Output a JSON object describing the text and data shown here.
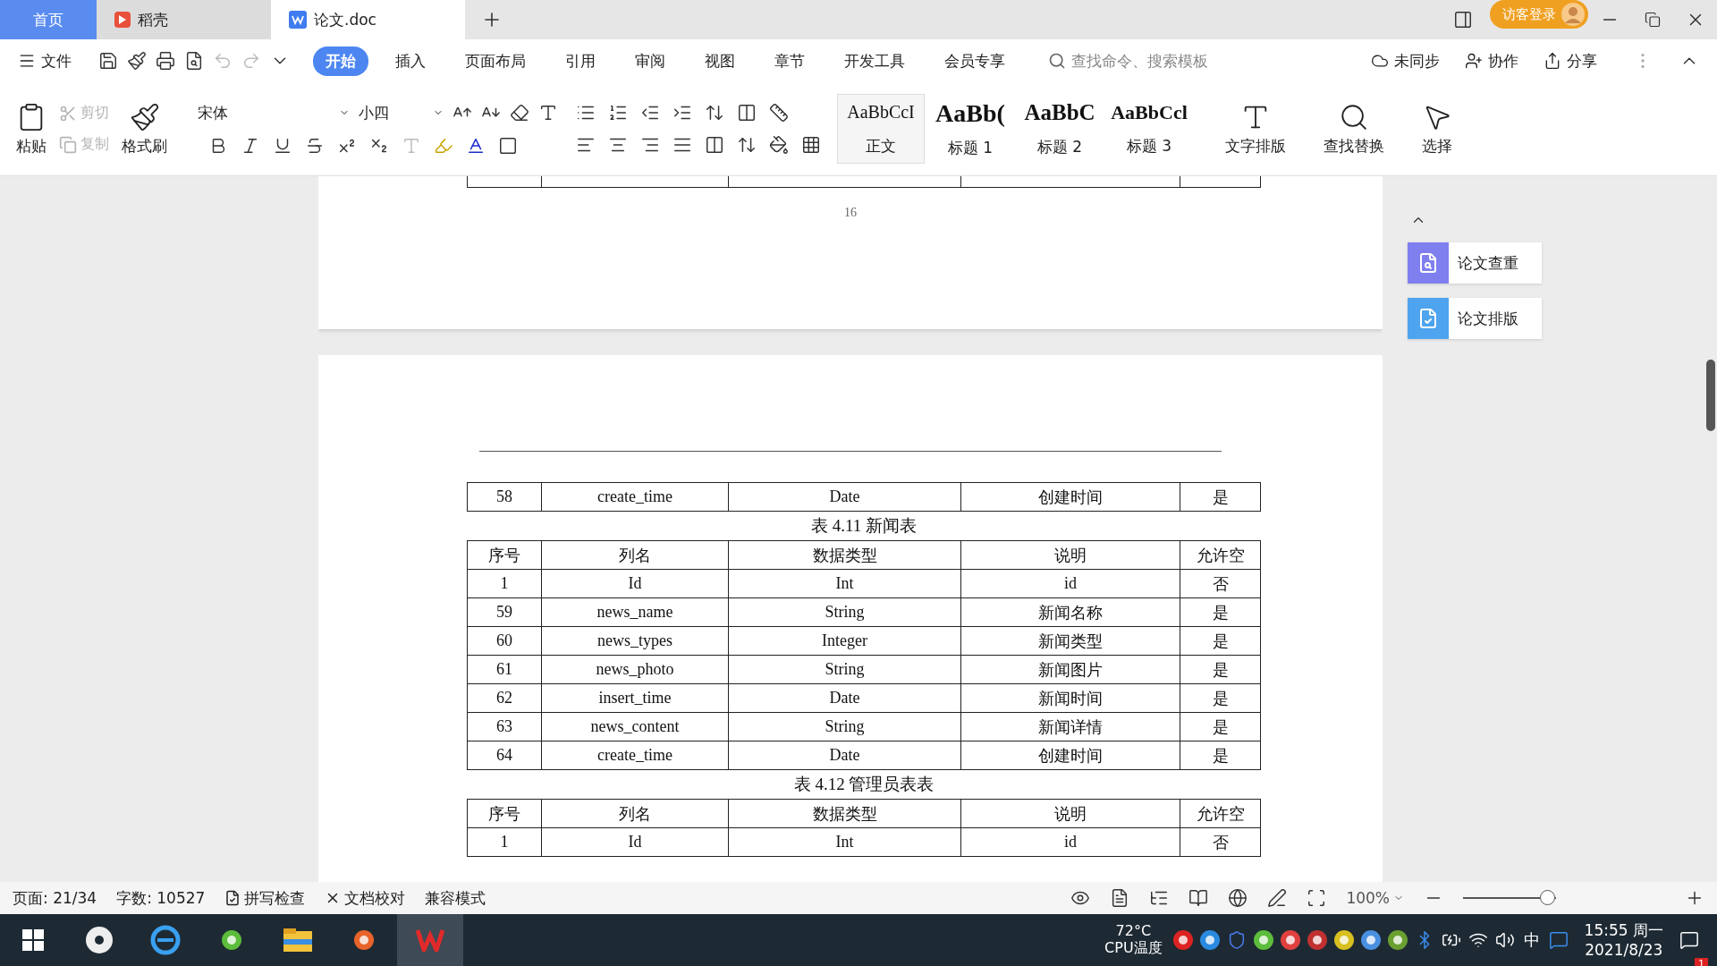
{
  "tabs": [
    {
      "label": "首页",
      "kind": "home",
      "selected": false
    },
    {
      "label": "稻壳",
      "kind": "docer",
      "selected": false
    },
    {
      "label": "论文.doc",
      "kind": "doc",
      "selected": true
    }
  ],
  "title_bar": {
    "login": "访客登录"
  },
  "menu": {
    "file": "文件",
    "items": [
      {
        "label": "开始",
        "selected": true
      },
      {
        "label": "插入",
        "selected": false
      },
      {
        "label": "页面布局",
        "selected": false
      },
      {
        "label": "引用",
        "selected": false
      },
      {
        "label": "审阅",
        "selected": false
      },
      {
        "label": "视图",
        "selected": false
      },
      {
        "label": "章节",
        "selected": false
      },
      {
        "label": "开发工具",
        "selected": false
      },
      {
        "label": "会员专享",
        "selected": false
      }
    ],
    "search": {
      "placeholder": "查找命令、搜索模板"
    },
    "actions": [
      {
        "kind": "sync",
        "label": "未同步"
      },
      {
        "kind": "collab",
        "label": "协作"
      },
      {
        "kind": "share",
        "label": "分享"
      }
    ]
  },
  "ribbon": {
    "paste": "粘贴",
    "cut": {
      "label": "剪切",
      "disabled": true
    },
    "copy": {
      "label": "复制",
      "disabled": true
    },
    "format_painter": "格式刷",
    "font": "宋体",
    "size": "小四",
    "styles": [
      {
        "sample": "AaBbCcI",
        "label": "正文",
        "kind": "body",
        "selected": true
      },
      {
        "sample": "AaBb(",
        "label": "标题 1",
        "kind": "h1",
        "selected": false
      },
      {
        "sample": "AaBbC",
        "label": "标题 2",
        "kind": "h2",
        "selected": false
      },
      {
        "sample": "AaBbCcl",
        "label": "标题 3",
        "kind": "h3",
        "selected": false
      }
    ],
    "tools": [
      {
        "kind": "layout",
        "label": "文字排版"
      },
      {
        "kind": "find",
        "label": "查找替换"
      },
      {
        "kind": "select",
        "label": "选择"
      }
    ]
  },
  "document": {
    "page_number": "16",
    "blocks": [
      {
        "kind": "table",
        "rows": [
          [
            "58",
            "create_time",
            "Date",
            "创建时间",
            "是"
          ]
        ]
      },
      {
        "kind": "caption",
        "text": "表 4.11 新闻表"
      },
      {
        "kind": "table",
        "columns": [
          "序号",
          "列名",
          "数据类型",
          "说明",
          "允许空"
        ],
        "rows": [
          [
            "1",
            "Id",
            "Int",
            "id",
            "否"
          ],
          [
            "59",
            "news_name",
            "String",
            "新闻名称",
            "是"
          ],
          [
            "60",
            "news_types",
            "Integer",
            "新闻类型",
            "是"
          ],
          [
            "61",
            "news_photo",
            "String",
            "新闻图片",
            "是"
          ],
          [
            "62",
            "insert_time",
            "Date",
            "新闻时间",
            "是"
          ],
          [
            "63",
            "news_content",
            "String",
            "新闻详情",
            "是"
          ],
          [
            "64",
            "create_time",
            "Date",
            "创建时间",
            "是"
          ]
        ]
      },
      {
        "kind": "caption",
        "text": "表 4.12 管理员表表"
      },
      {
        "kind": "table",
        "columns": [
          "序号",
          "列名",
          "数据类型",
          "说明",
          "允许空"
        ],
        "rows": [
          [
            "1",
            "Id",
            "Int",
            "id",
            "否"
          ]
        ]
      }
    ]
  },
  "side_panel": {
    "buttons": [
      {
        "kind": "check",
        "label": "论文查重"
      },
      {
        "kind": "format",
        "label": "论文排版"
      }
    ]
  },
  "status_bar": {
    "page": "页面: 21/34",
    "words": "字数: 10527",
    "tools": [
      {
        "kind": "spell",
        "label": "拼写检查"
      },
      {
        "kind": "proof",
        "label": "文档校对"
      }
    ],
    "mode": "兼容模式",
    "zoom": "100%",
    "zoom_slider": {
      "level": 1
    }
  },
  "taskbar": {
    "temperature": "72°C",
    "sensor_label": "CPU温度",
    "ime": "中",
    "time": "15:55 周一",
    "date": "2021/8/23",
    "notifications": "1"
  }
}
